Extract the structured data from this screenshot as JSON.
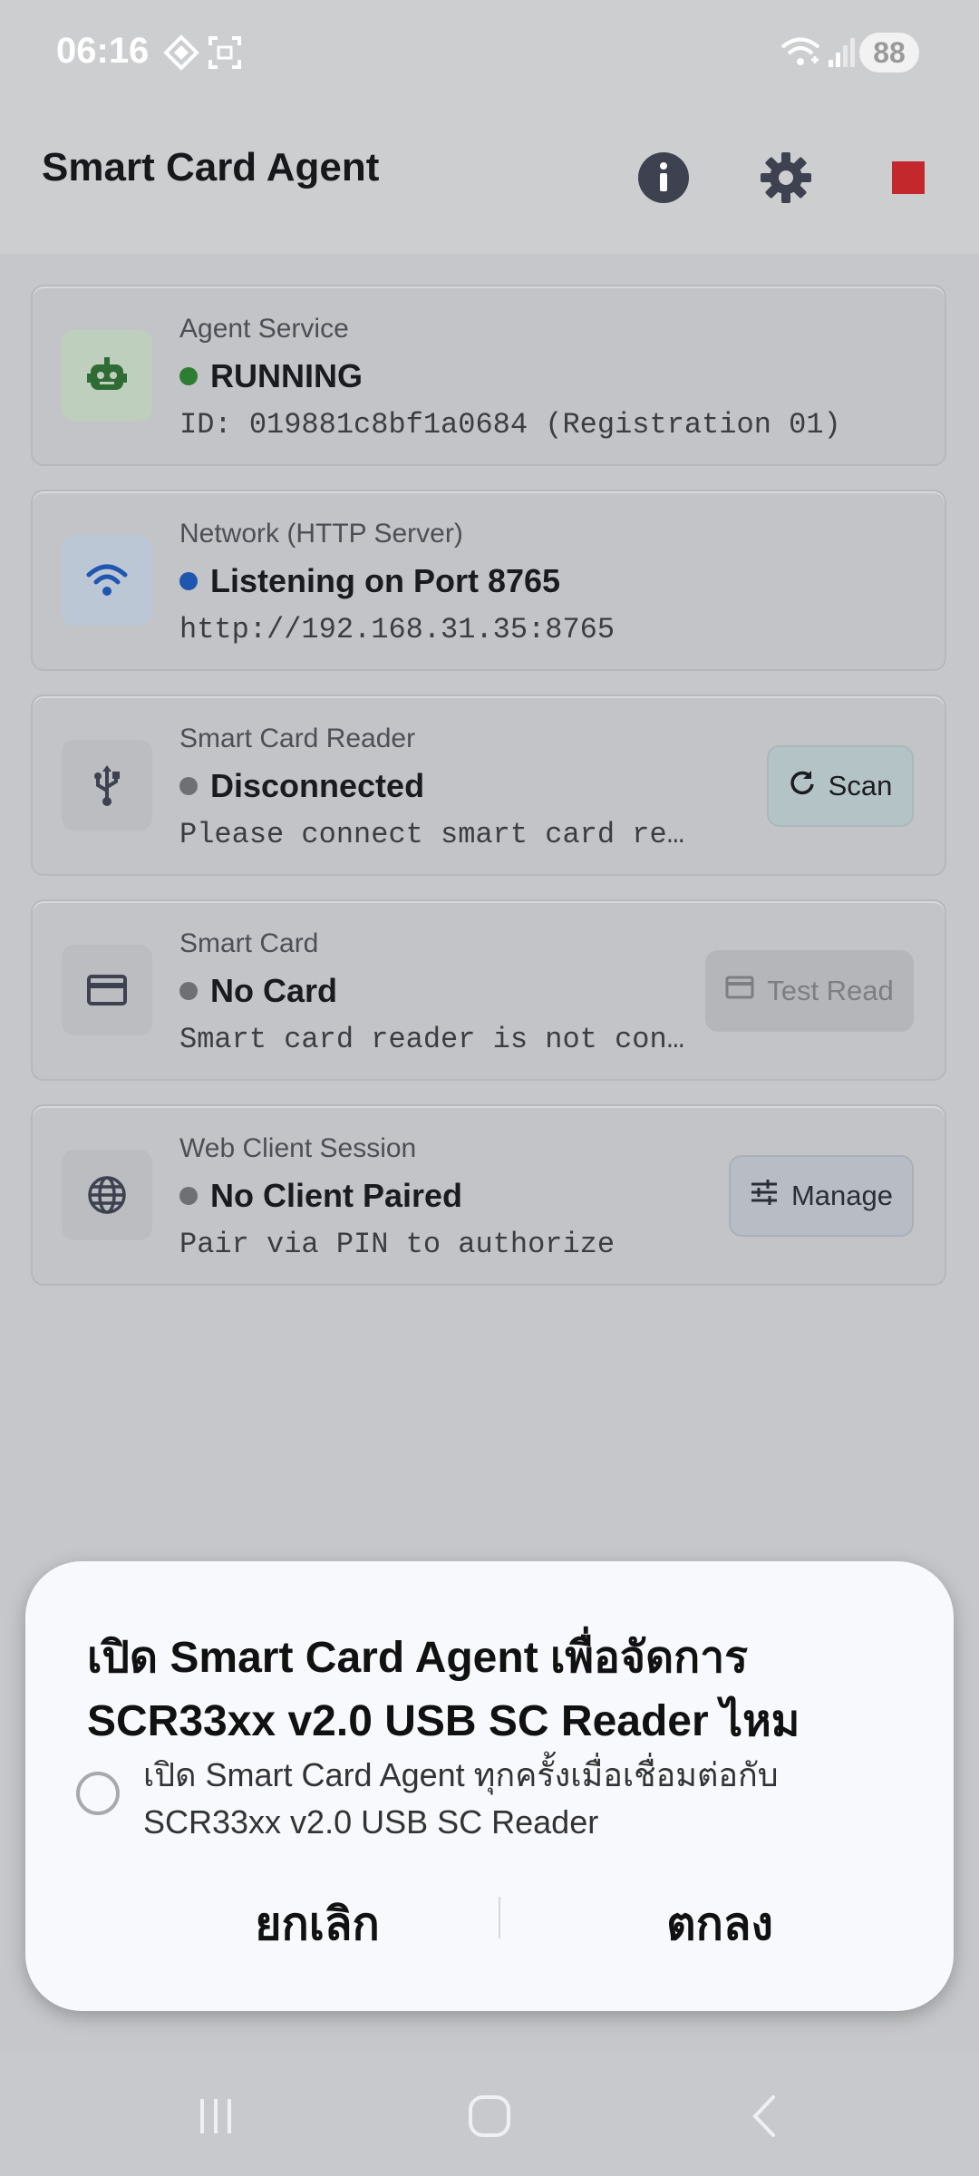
{
  "status_bar": {
    "time": "06:16",
    "battery": "88",
    "left_icons": [
      "notification-diamond-icon",
      "screenshot-icon"
    ],
    "right_icons": [
      "wifi-icon",
      "signal-icon"
    ]
  },
  "app_bar": {
    "title": "Smart Card Agent",
    "actions": [
      "info-icon",
      "settings-icon",
      "stop-icon"
    ],
    "stop_color": "#c3292c"
  },
  "cards": [
    {
      "label": "Agent Service",
      "status": "RUNNING",
      "status_color": "#2e7d32",
      "subtitle": "ID: 019881c8bf1a0684 (Registration 01)",
      "icon": "robot-icon"
    },
    {
      "label": "Network (HTTP Server)",
      "status": "Listening on Port 8765",
      "status_color": "#1e56b0",
      "subtitle": "http://192.168.31.35:8765",
      "icon": "wifi-icon"
    },
    {
      "label": "Smart Card Reader",
      "status": "Disconnected",
      "status_color": "#6f7073",
      "subtitle": "Please connect smart card reader",
      "icon": "usb-icon",
      "button": "Scan",
      "button_icon": "refresh-icon"
    },
    {
      "label": "Smart Card",
      "status": "No Card",
      "status_color": "#6f7073",
      "subtitle": "Smart card reader is not con…",
      "icon": "credit-card-icon",
      "button": "Test Read",
      "button_icon": "card-icon",
      "button_disabled": true
    },
    {
      "label": "Web Client Session",
      "status": "No Client Paired",
      "status_color": "#6f7073",
      "subtitle": "Pair via PIN to authorize",
      "icon": "globe-icon",
      "button": "Manage",
      "button_icon": "sliders-icon"
    }
  ],
  "dialog": {
    "title": "เปิด Smart Card Agent เพื่อจัดการ SCR33xx v2.0 USB SC Reader ไหม",
    "checkbox_label": "เปิด Smart Card Agent ทุกครั้งเมื่อเชื่อมต่อกับ SCR33xx v2.0 USB SC Reader",
    "checkbox_checked": false,
    "cancel_label": "ยกเลิก",
    "ok_label": "ตกลง"
  },
  "nav_bar": [
    "recent-apps-icon",
    "home-icon",
    "back-icon"
  ]
}
